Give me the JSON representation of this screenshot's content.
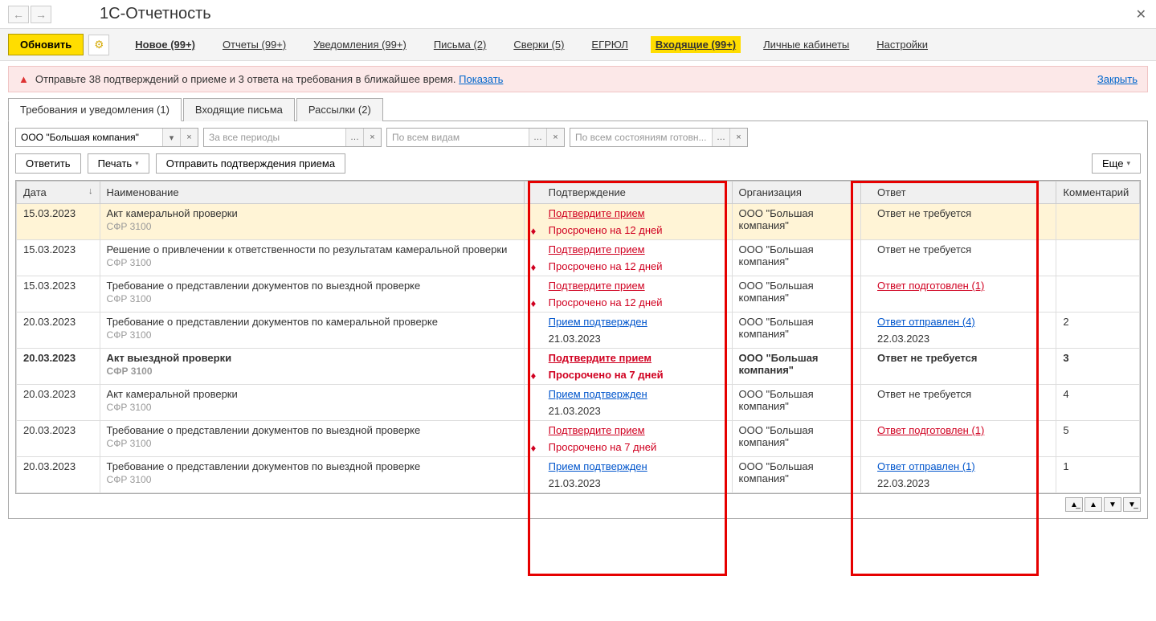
{
  "title": "1С-Отчетность",
  "toolbar": {
    "refresh": "Обновить",
    "links": [
      {
        "label": "Новое (99+)",
        "bold": true
      },
      {
        "label": "Отчеты (99+)"
      },
      {
        "label": "Уведомления (99+)"
      },
      {
        "label": "Письма (2)"
      },
      {
        "label": "Сверки (5)"
      },
      {
        "label": "ЕГРЮЛ"
      },
      {
        "label": "Входящие (99+)",
        "active": true
      },
      {
        "label": "Личные кабинеты"
      },
      {
        "label": "Настройки"
      }
    ]
  },
  "alert": {
    "text": "Отправьте 38 подтверждений о приеме и 3 ответа на требования в ближайшее время.",
    "show_link": "Показать",
    "close": "Закрыть"
  },
  "tabs": [
    {
      "label": "Требования и уведомления (1)",
      "active": true
    },
    {
      "label": "Входящие письма"
    },
    {
      "label": "Рассылки (2)"
    }
  ],
  "filters": {
    "org_value": "ООО \"Большая компания\"",
    "period_placeholder": "За все периоды",
    "type_placeholder": "По всем видам",
    "state_placeholder": "По всем состояниям готовн..."
  },
  "actions": {
    "reply": "Ответить",
    "print": "Печать",
    "send_conf": "Отправить подтверждения приема",
    "more": "Еще"
  },
  "columns": {
    "date": "Дата",
    "name": "Наименование",
    "conf": "Подтверждение",
    "org": "Организация",
    "ans": "Ответ",
    "com": "Комментарий"
  },
  "rows": [
    {
      "date": "15.03.2023",
      "bold": false,
      "selected": true,
      "name": "Акт камеральной проверки",
      "sub": "СФР 3100",
      "conf_link": "Подтвердите прием",
      "conf_sub": "Просрочено на 12 дней",
      "conf_red": true,
      "fire": true,
      "org": "ООО \"Большая компания\"",
      "ans_text": "Ответ не требуется",
      "ans_link": false,
      "ans_red": false,
      "ans_sub": "",
      "com": ""
    },
    {
      "date": "15.03.2023",
      "bold": false,
      "name": "Решение о привлечении к ответственности по результатам камеральной проверки",
      "sub": "СФР 3100",
      "conf_link": "Подтвердите прием",
      "conf_sub": "Просрочено на 12 дней",
      "conf_red": true,
      "fire": true,
      "org": "ООО \"Большая компания\"",
      "ans_text": "Ответ не требуется",
      "ans_link": false,
      "ans_red": false,
      "ans_sub": "",
      "com": ""
    },
    {
      "date": "15.03.2023",
      "bold": false,
      "name": "Требование о представлении документов по выездной проверке",
      "sub": "СФР 3100",
      "conf_link": "Подтвердите прием",
      "conf_sub": "Просрочено на 12 дней",
      "conf_red": true,
      "fire": true,
      "org": "ООО \"Большая компания\"",
      "ans_text": "Ответ подготовлен (1)",
      "ans_link": true,
      "ans_red": true,
      "ans_sub": "",
      "com": ""
    },
    {
      "date": "20.03.2023",
      "bold": false,
      "name": "Требование о представлении документов по камеральной проверке",
      "sub": "СФР 3100",
      "conf_link": "Прием подтвержден",
      "conf_sub": "21.03.2023",
      "conf_red": false,
      "fire": false,
      "org": "ООО \"Большая компания\"",
      "ans_text": "Ответ отправлен (4)",
      "ans_link": true,
      "ans_red": false,
      "ans_sub": "22.03.2023",
      "com": "2"
    },
    {
      "date": "20.03.2023",
      "bold": true,
      "name": "Акт выездной проверки",
      "sub": "СФР 3100",
      "conf_link": "Подтвердите прием",
      "conf_sub": "Просрочено на 7 дней",
      "conf_red": true,
      "fire": true,
      "org": "ООО \"Большая компания\"",
      "ans_text": "Ответ не требуется",
      "ans_link": false,
      "ans_red": false,
      "ans_sub": "",
      "com": "3"
    },
    {
      "date": "20.03.2023",
      "bold": false,
      "name": "Акт камеральной проверки",
      "sub": "СФР 3100",
      "conf_link": "Прием подтвержден",
      "conf_sub": "21.03.2023",
      "conf_red": false,
      "fire": false,
      "org": "ООО \"Большая компания\"",
      "ans_text": "Ответ не требуется",
      "ans_link": false,
      "ans_red": false,
      "ans_sub": "",
      "com": "4"
    },
    {
      "date": "20.03.2023",
      "bold": false,
      "name": "Требование о представлении документов по выездной проверке",
      "sub": "СФР 3100",
      "conf_link": "Подтвердите прием",
      "conf_sub": "Просрочено на 7 дней",
      "conf_red": true,
      "fire": true,
      "org": "ООО \"Большая компания\"",
      "ans_text": "Ответ подготовлен (1)",
      "ans_link": true,
      "ans_red": true,
      "ans_sub": "",
      "com": "5"
    },
    {
      "date": "20.03.2023",
      "bold": false,
      "name": "Требование о представлении документов по выездной проверке",
      "sub": "СФР 3100",
      "conf_link": "Прием подтвержден",
      "conf_sub": "21.03.2023",
      "conf_red": false,
      "fire": false,
      "org": "ООО \"Большая компания\"",
      "ans_text": "Ответ отправлен (1)",
      "ans_link": true,
      "ans_red": false,
      "ans_sub": "22.03.2023",
      "com": "1"
    }
  ]
}
